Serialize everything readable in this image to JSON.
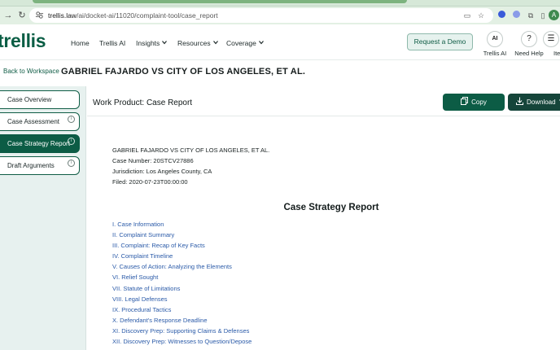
{
  "browser": {
    "url_domain": "trellis.law",
    "url_path": "/ai/docket-ai/11020/complaint-tool/case_report",
    "profile_initial": "A"
  },
  "header": {
    "logo": "trellis",
    "nav": [
      {
        "label": "Home"
      },
      {
        "label": "Trellis AI"
      },
      {
        "label": "Insights"
      },
      {
        "label": "Resources"
      },
      {
        "label": "Coverage"
      }
    ],
    "demo_label": "Request a Demo",
    "tools": [
      {
        "label": "Trellis AI",
        "glyph": "AI"
      },
      {
        "label": "Need Help",
        "glyph": "?"
      },
      {
        "label": "Ite",
        "glyph": "☰"
      }
    ]
  },
  "title_row": {
    "back_label": "Back to Workspace",
    "case_title": "GABRIEL FAJARDO VS CITY OF LOS ANGELES, ET AL."
  },
  "sidebar": {
    "items": [
      {
        "label": "Case Overview",
        "active": false,
        "info": false
      },
      {
        "label": "Case Assessment",
        "active": false,
        "info": true
      },
      {
        "label": "Case Strategy Report",
        "active": true,
        "info": true
      },
      {
        "label": "Draft Arguments",
        "active": false,
        "info": true
      }
    ]
  },
  "main": {
    "work_product_title": "Work Product: Case Report",
    "copy_label": "Copy",
    "download_label": "Download",
    "meta": [
      "GABRIEL FAJARDO VS CITY OF LOS ANGELES, ET AL.",
      "Case Number: 20STCV27886",
      "Jurisdiction: Los Angeles County, CA",
      "Filed: 2020-07-23T00:00:00"
    ],
    "report_heading": "Case Strategy Report",
    "toc": [
      "I. Case Information",
      "II. Complaint Summary",
      "III. Complaint: Recap of Key Facts",
      "IV. Complaint Timeline",
      "V. Causes of Action: Analyzing the Elements",
      "VI. Relief Sought",
      "VII. Statute of Limitations",
      "VIII. Legal Defenses",
      "IX. Procedural Tactics",
      "X. Defendant's Response Deadline",
      "XI. Discovery Prep: Supporting Claims & Defenses",
      "XII. Discovery Prep: Witnesses to Question/Depose"
    ]
  },
  "colors": {
    "brand_green": "#0c5c45",
    "sidebar_bg": "#e7f1ef",
    "link_blue": "#2a5aa8"
  }
}
